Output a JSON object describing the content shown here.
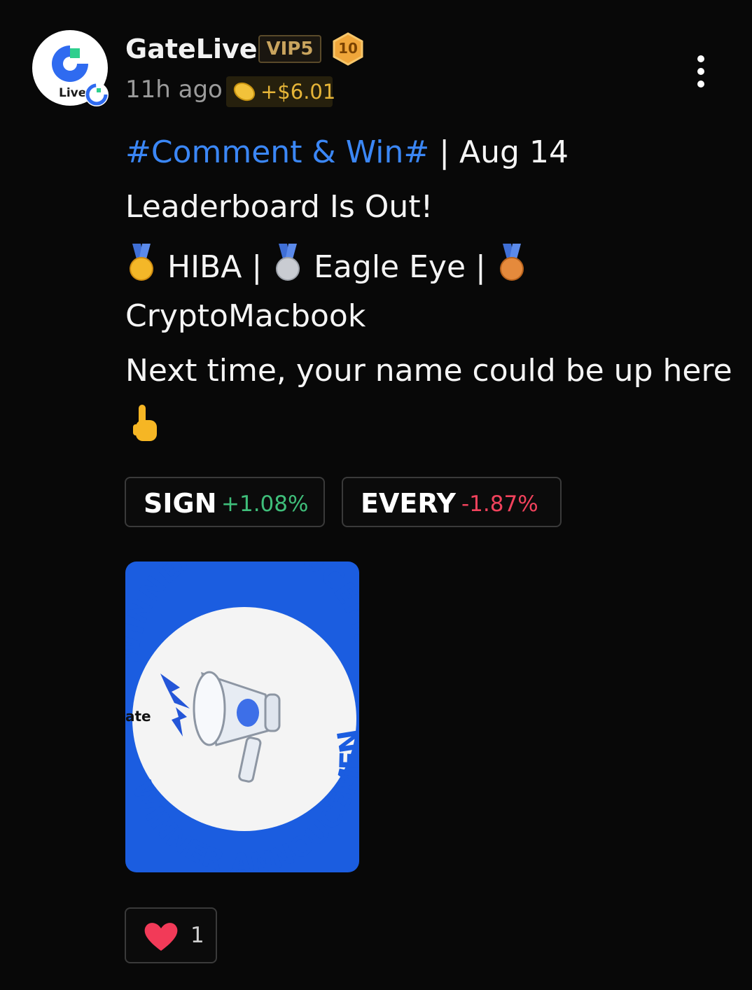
{
  "post": {
    "author": {
      "name": "GateLive",
      "avatar_label": "Live",
      "vip": "VIP5",
      "level": "10"
    },
    "meta": {
      "time": "11h ago",
      "reward": "+$6.01"
    },
    "content": {
      "hashtag": "#Comment & Win#",
      "date": " | Aug 14",
      "line2": "Leaderboard Is Out!",
      "winner1": " HIBA | ",
      "winner2": " Eagle Eye | ",
      "winner3": "CryptoMacbook",
      "line5": "Next time, your name could be up here"
    },
    "tickers": [
      {
        "symbol": "SIGN",
        "change": "+1.08%",
        "color": "#3fbe7a"
      },
      {
        "symbol": "EVERY",
        "change": "-1.87%",
        "color": "#f0425c"
      }
    ],
    "image": {
      "top_text": "WINNER ANNOUCEMENT",
      "bottom_text": "WINNER ANNOUCEMENT",
      "side_text": "ate"
    },
    "reactions": {
      "likes": "1"
    }
  },
  "colors": {
    "background": "#080808",
    "hashtag": "#3b87f6",
    "reward": "#e6b538",
    "vip": "#c9a45e",
    "positive": "#3fbe7a",
    "negative": "#f0425c",
    "image_blue": "#1b5de0"
  },
  "icons": [
    "gate-logo-icon",
    "level-badge-icon",
    "coin-icon",
    "more-icon",
    "gold-medal-icon",
    "silver-medal-icon",
    "bronze-medal-icon",
    "pointing-hand-icon",
    "megaphone-icon",
    "heart-icon"
  ]
}
